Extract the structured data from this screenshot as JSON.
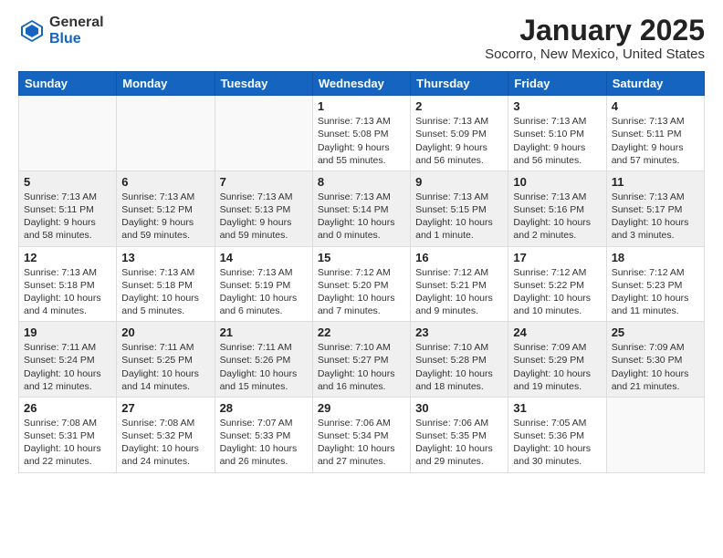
{
  "logo": {
    "general": "General",
    "blue": "Blue"
  },
  "title": "January 2025",
  "location": "Socorro, New Mexico, United States",
  "days_of_week": [
    "Sunday",
    "Monday",
    "Tuesday",
    "Wednesday",
    "Thursday",
    "Friday",
    "Saturday"
  ],
  "weeks": [
    [
      {
        "day": "",
        "info": ""
      },
      {
        "day": "",
        "info": ""
      },
      {
        "day": "",
        "info": ""
      },
      {
        "day": "1",
        "info": "Sunrise: 7:13 AM\nSunset: 5:08 PM\nDaylight: 9 hours and 55 minutes."
      },
      {
        "day": "2",
        "info": "Sunrise: 7:13 AM\nSunset: 5:09 PM\nDaylight: 9 hours and 56 minutes."
      },
      {
        "day": "3",
        "info": "Sunrise: 7:13 AM\nSunset: 5:10 PM\nDaylight: 9 hours and 56 minutes."
      },
      {
        "day": "4",
        "info": "Sunrise: 7:13 AM\nSunset: 5:11 PM\nDaylight: 9 hours and 57 minutes."
      }
    ],
    [
      {
        "day": "5",
        "info": "Sunrise: 7:13 AM\nSunset: 5:11 PM\nDaylight: 9 hours and 58 minutes."
      },
      {
        "day": "6",
        "info": "Sunrise: 7:13 AM\nSunset: 5:12 PM\nDaylight: 9 hours and 59 minutes."
      },
      {
        "day": "7",
        "info": "Sunrise: 7:13 AM\nSunset: 5:13 PM\nDaylight: 9 hours and 59 minutes."
      },
      {
        "day": "8",
        "info": "Sunrise: 7:13 AM\nSunset: 5:14 PM\nDaylight: 10 hours and 0 minutes."
      },
      {
        "day": "9",
        "info": "Sunrise: 7:13 AM\nSunset: 5:15 PM\nDaylight: 10 hours and 1 minute."
      },
      {
        "day": "10",
        "info": "Sunrise: 7:13 AM\nSunset: 5:16 PM\nDaylight: 10 hours and 2 minutes."
      },
      {
        "day": "11",
        "info": "Sunrise: 7:13 AM\nSunset: 5:17 PM\nDaylight: 10 hours and 3 minutes."
      }
    ],
    [
      {
        "day": "12",
        "info": "Sunrise: 7:13 AM\nSunset: 5:18 PM\nDaylight: 10 hours and 4 minutes."
      },
      {
        "day": "13",
        "info": "Sunrise: 7:13 AM\nSunset: 5:18 PM\nDaylight: 10 hours and 5 minutes."
      },
      {
        "day": "14",
        "info": "Sunrise: 7:13 AM\nSunset: 5:19 PM\nDaylight: 10 hours and 6 minutes."
      },
      {
        "day": "15",
        "info": "Sunrise: 7:12 AM\nSunset: 5:20 PM\nDaylight: 10 hours and 7 minutes."
      },
      {
        "day": "16",
        "info": "Sunrise: 7:12 AM\nSunset: 5:21 PM\nDaylight: 10 hours and 9 minutes."
      },
      {
        "day": "17",
        "info": "Sunrise: 7:12 AM\nSunset: 5:22 PM\nDaylight: 10 hours and 10 minutes."
      },
      {
        "day": "18",
        "info": "Sunrise: 7:12 AM\nSunset: 5:23 PM\nDaylight: 10 hours and 11 minutes."
      }
    ],
    [
      {
        "day": "19",
        "info": "Sunrise: 7:11 AM\nSunset: 5:24 PM\nDaylight: 10 hours and 12 minutes."
      },
      {
        "day": "20",
        "info": "Sunrise: 7:11 AM\nSunset: 5:25 PM\nDaylight: 10 hours and 14 minutes."
      },
      {
        "day": "21",
        "info": "Sunrise: 7:11 AM\nSunset: 5:26 PM\nDaylight: 10 hours and 15 minutes."
      },
      {
        "day": "22",
        "info": "Sunrise: 7:10 AM\nSunset: 5:27 PM\nDaylight: 10 hours and 16 minutes."
      },
      {
        "day": "23",
        "info": "Sunrise: 7:10 AM\nSunset: 5:28 PM\nDaylight: 10 hours and 18 minutes."
      },
      {
        "day": "24",
        "info": "Sunrise: 7:09 AM\nSunset: 5:29 PM\nDaylight: 10 hours and 19 minutes."
      },
      {
        "day": "25",
        "info": "Sunrise: 7:09 AM\nSunset: 5:30 PM\nDaylight: 10 hours and 21 minutes."
      }
    ],
    [
      {
        "day": "26",
        "info": "Sunrise: 7:08 AM\nSunset: 5:31 PM\nDaylight: 10 hours and 22 minutes."
      },
      {
        "day": "27",
        "info": "Sunrise: 7:08 AM\nSunset: 5:32 PM\nDaylight: 10 hours and 24 minutes."
      },
      {
        "day": "28",
        "info": "Sunrise: 7:07 AM\nSunset: 5:33 PM\nDaylight: 10 hours and 26 minutes."
      },
      {
        "day": "29",
        "info": "Sunrise: 7:06 AM\nSunset: 5:34 PM\nDaylight: 10 hours and 27 minutes."
      },
      {
        "day": "30",
        "info": "Sunrise: 7:06 AM\nSunset: 5:35 PM\nDaylight: 10 hours and 29 minutes."
      },
      {
        "day": "31",
        "info": "Sunrise: 7:05 AM\nSunset: 5:36 PM\nDaylight: 10 hours and 30 minutes."
      },
      {
        "day": "",
        "info": ""
      }
    ]
  ]
}
